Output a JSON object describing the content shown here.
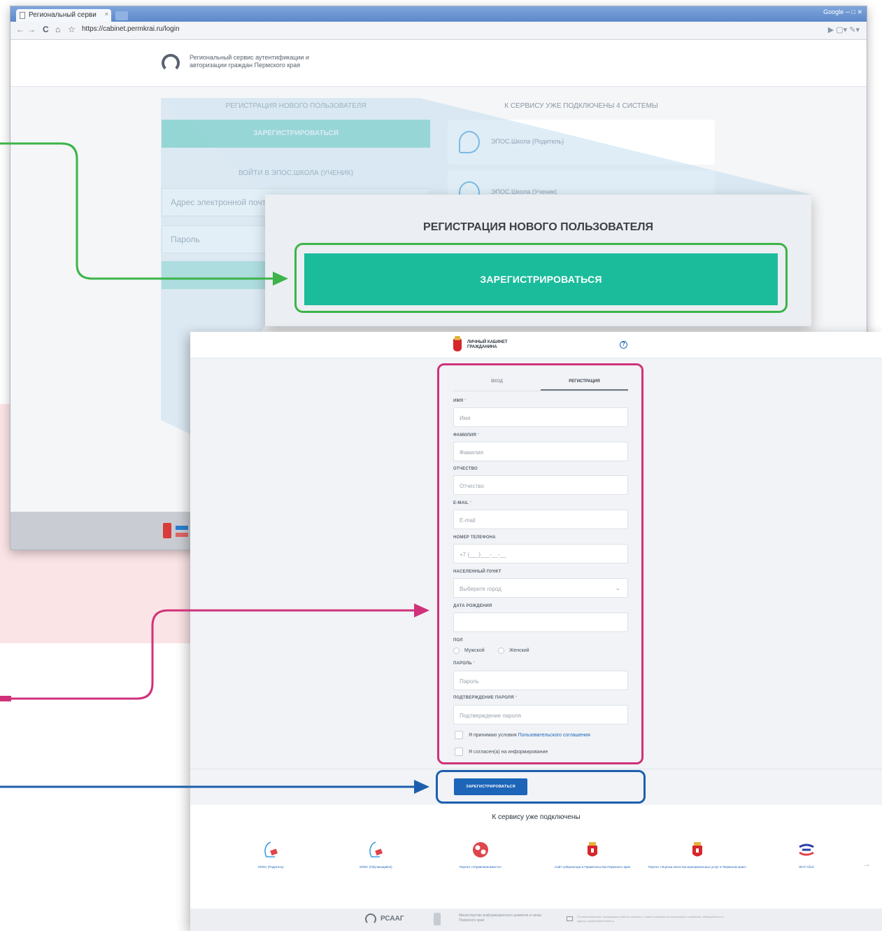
{
  "browser": {
    "tab_title": "Региональный серви",
    "tab_close": "×",
    "window_controls": "Google  ─  □  ✕",
    "nav_back": "←",
    "nav_forward": "→",
    "nav_reload": "C",
    "nav_home": "⌂",
    "nav_star": "☆",
    "url": "https://cabinet.permkrai.ru/login",
    "nav_right": "▶ ▢▾ ✎▾"
  },
  "site": {
    "title": "Региональный сервис аутентификации и авторизации граждан Пермского края",
    "register_heading": "РЕГИСТРАЦИЯ НОВОГО ПОЛЬЗОВАТЕЛЯ",
    "register_button": "ЗАРЕГИСТРИРОВАТЬСЯ",
    "login_heading": "ВОЙТИ В ЭПОС.ШКОЛА (УЧЕНИК)",
    "email_placeholder": "Адрес электронной почты",
    "password_placeholder": "Пароль",
    "systems_heading": "К СЕРВИСУ УЖЕ ПОДКЛЮЧЕНЫ 4 СИСТЕМЫ",
    "systems": [
      "ЭПОС.Школа (Родитель)",
      "ЭПОС.Школа (Ученик)"
    ]
  },
  "zoom": {
    "heading": "РЕГИСТРАЦИЯ НОВОГО ПОЛЬЗОВАТЕЛЯ",
    "button": "ЗАРЕГИСТРИРОВАТЬСЯ"
  },
  "form": {
    "brand": "ЛИЧНЫЙ КАБИНЕТ ГРАЖДАНИНА",
    "help_icon": "?",
    "tab_login": "ВХОД",
    "tab_register": "РЕГИСТРАЦИЯ",
    "required_mark": "*",
    "fields": {
      "first_name": {
        "label": "ИМЯ",
        "placeholder": "Имя"
      },
      "last_name": {
        "label": "ФАМИЛИЯ",
        "placeholder": "Фамилия"
      },
      "patronymic": {
        "label": "ОТЧЕСТВО",
        "placeholder": "Отчество"
      },
      "email": {
        "label": "E-MAIL",
        "placeholder": "E-mail"
      },
      "phone": {
        "label": "НОМЕР ТЕЛЕФОНА",
        "placeholder": "+7 (___)___-__-__"
      },
      "city": {
        "label": "НАСЕЛЕННЫЙ ПУНКТ",
        "placeholder": "Выберите город"
      },
      "birthdate": {
        "label": "ДАТА РОЖДЕНИЯ",
        "placeholder": ""
      },
      "gender": {
        "label": "ПОЛ",
        "male": "Мужской",
        "female": "Женский"
      },
      "password": {
        "label": "ПАРОЛЬ",
        "placeholder": "Пароль"
      },
      "password_confirm": {
        "label": "ПОДТВЕРЖДЕНИЕ ПАРОЛЯ",
        "placeholder": "Подтверждение пароля"
      }
    },
    "agree_prefix": "Я принимаю условия ",
    "agree_link": "Пользовательского соглашения",
    "consent": "Я согласен(а) на информирование",
    "submit": "ЗАРЕГИСТРИРОВАТЬСЯ"
  },
  "connected": {
    "title": "К сервису уже подключены",
    "services": [
      "ЭПОС (Родитель)",
      "ЭПОС (Обучающийся)",
      "Портал «Управляем вместе»",
      "Сайт губернатора и Правительства Пермского края",
      "Портал «Оценка качества муниципальных услуг в Пермском крае»",
      "Wi-Fi Click"
    ],
    "next_arrow": "→"
  },
  "footer": {
    "name": "РСААГ",
    "ministry": "Министерство информационного развития и связи Пермского края",
    "note": "По всем вопросам, касающимся работы сервиса, а также возможности интеграции с сервисом, обращайтесь по адресу: support@permkrai.ru"
  },
  "colors": {
    "green_highlight": "#3cb449",
    "pink_highlight": "#d0327a",
    "blue_highlight": "#1d5fae",
    "teal_button": "#1abc9c",
    "blue_button": "#1d65b8"
  }
}
